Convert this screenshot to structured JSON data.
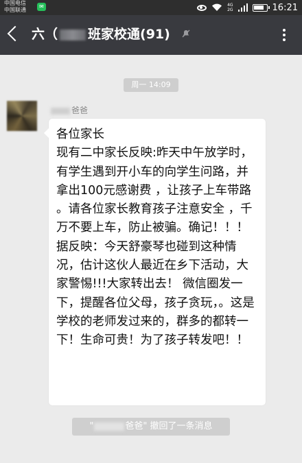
{
  "status_bar": {
    "carrier_1": "中国电信",
    "carrier_2": "中国联通",
    "network_label_top": "4G",
    "network_label_bottom": "2G",
    "time": "16:21",
    "icons": [
      "wechat-icon",
      "eye-icon",
      "wifi-icon",
      "signal-icon",
      "battery-icon"
    ]
  },
  "chat_header": {
    "title_prefix": "六（",
    "title_suffix": "班家校通(91)",
    "icons": [
      "back-icon",
      "mute-icon",
      "more-icon"
    ]
  },
  "messages": {
    "timestamp": "周一 14:09",
    "sender_suffix": "爸爸",
    "text": "各位家长\n现有二中家长反映:昨天中午放学时，有学生遇到开小车的向学生问路，并拿出100元感谢费 ，让孩子上车带路 。请各位家长教育孩子注意安全 ，千万不要上车，防止被骗。确记！！！  据反映：今天舒豪琴也碰到这种情况，估计这伙人最近在乡下活动，大家警惕!!!大家转出去！ 微信圈发一下，提醒各位父母，孩子贪玩，。这是学校的老师发过来的，群多的都转一下！生命可贵！为了孩子转发吧！！"
  },
  "recall_notice": {
    "open_quote": "\"",
    "suffix": "爸爸\" 撤回了一条消息"
  },
  "colors": {
    "background": "#ebebeb",
    "status_bar": "#2e2e2e",
    "title_bar": "#393a3f",
    "bubble": "#ffffff",
    "system_tag": "#cecece"
  }
}
